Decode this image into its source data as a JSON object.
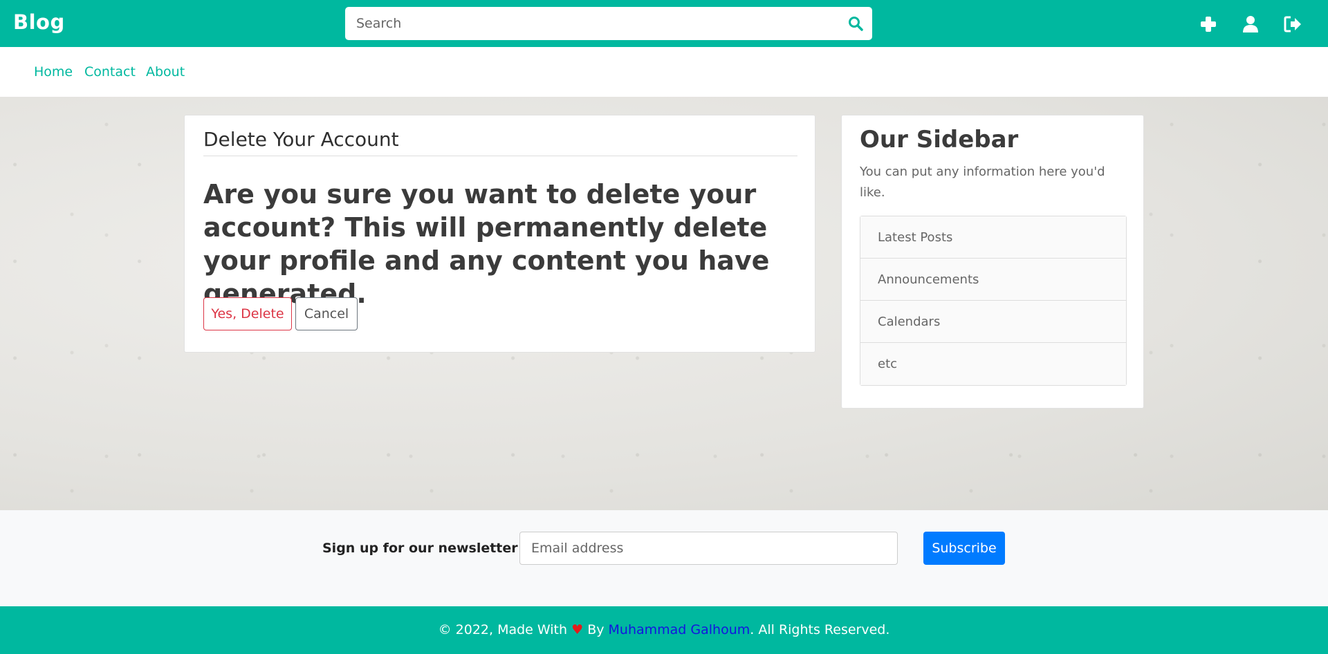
{
  "header": {
    "brand": "Blog",
    "search_placeholder": "Search",
    "icons": [
      "plus-icon",
      "user-icon",
      "sign-out-icon"
    ]
  },
  "nav": {
    "items": [
      {
        "label": "Home"
      },
      {
        "label": "Contact"
      },
      {
        "label": "About"
      }
    ]
  },
  "main": {
    "title": "Delete Your Account",
    "warning": "Are you sure you want to delete your account? This will permanently delete your profile and any content you have generated.",
    "confirm_label": "Yes, Delete",
    "cancel_label": "Cancel"
  },
  "sidebar": {
    "title": "Our Sidebar",
    "description": "You can put any information here you'd like.",
    "items": [
      {
        "label": "Latest Posts"
      },
      {
        "label": "Announcements"
      },
      {
        "label": "Calendars"
      },
      {
        "label": "etc"
      }
    ]
  },
  "newsletter": {
    "label": "Sign up for our newsletter",
    "email_placeholder": "Email address",
    "button_label": "Subscribe"
  },
  "footer": {
    "prefix": "© 2022, Made With",
    "heart": "♥",
    "by": "By",
    "author": "Muhammad Galhoum",
    "suffix": ". All Rights Reserved."
  },
  "colors": {
    "brand": "#00b89f",
    "danger": "#dc3545",
    "primary": "#007bff",
    "author_link": "#1414e0",
    "heart": "#e31b1b"
  }
}
